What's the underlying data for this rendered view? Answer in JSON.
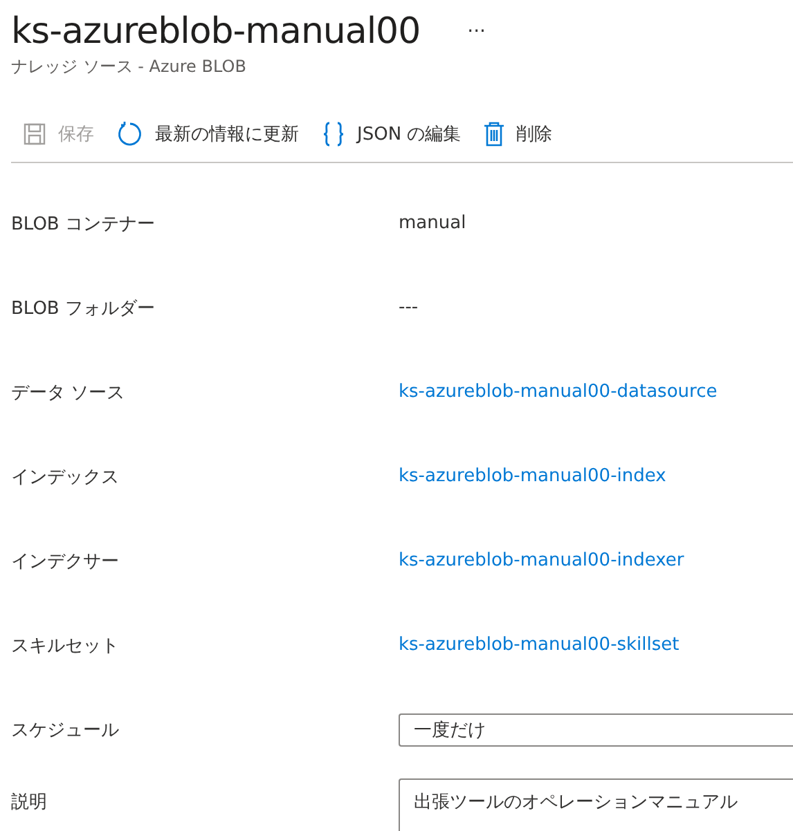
{
  "header": {
    "title": "ks-azureblob-manual00",
    "more": "···",
    "subtitle": "ナレッジ ソース - Azure BLOB"
  },
  "toolbar": [
    {
      "kind": "save",
      "label": "保存",
      "disabled": true
    },
    {
      "kind": "refresh",
      "label": "最新の情報に更新",
      "disabled": false
    },
    {
      "kind": "json",
      "label": "JSON の編集",
      "disabled": false
    },
    {
      "kind": "delete",
      "label": "削除",
      "disabled": false
    }
  ],
  "fields": [
    {
      "kind": "text",
      "label": "BLOB コンテナー",
      "value": "manual"
    },
    {
      "kind": "text",
      "label": "BLOB フォルダー",
      "value": "---"
    },
    {
      "kind": "link",
      "label": "データ ソース",
      "value": "ks-azureblob-manual00-datasource"
    },
    {
      "kind": "link",
      "label": "インデックス",
      "value": "ks-azureblob-manual00-index"
    },
    {
      "kind": "link",
      "label": "インデクサー",
      "value": "ks-azureblob-manual00-indexer"
    },
    {
      "kind": "link",
      "label": "スキルセット",
      "value": "ks-azureblob-manual00-skillset"
    },
    {
      "kind": "select",
      "label": "スケジュール",
      "value": "一度だけ"
    },
    {
      "kind": "textarea",
      "label": "説明",
      "value": "出張ツールのオペレーションマニュアル"
    }
  ]
}
